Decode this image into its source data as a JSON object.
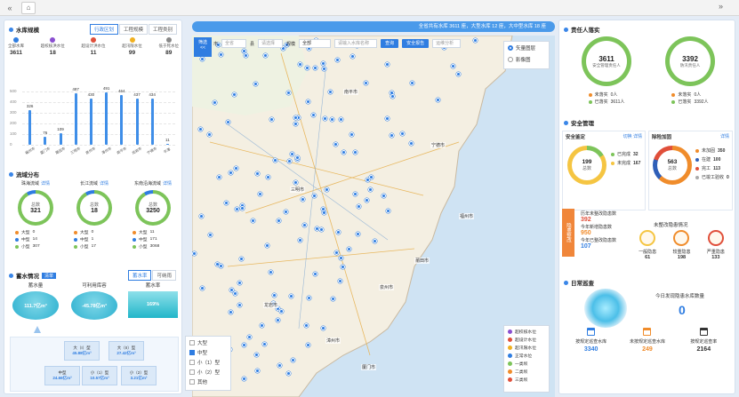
{
  "topbar": {
    "back": "«",
    "home": "⌂",
    "forward": "»"
  },
  "marquee": {
    "text": "全省共有水库 3611 座，大型水库 12 座，大中型水库 18 座"
  },
  "reservoir_scale": {
    "title": "水库规模",
    "tabs": [
      "行政区划",
      "工程规模",
      "工程类别"
    ],
    "stats": [
      {
        "label": "全部水库",
        "value": "3611",
        "color": "#2f7de1"
      },
      {
        "label": "超校核洪水位",
        "value": "18",
        "color": "#8a4fd0"
      },
      {
        "label": "超设计洪水位",
        "value": "11",
        "color": "#e04f3a"
      },
      {
        "label": "超汛限水位",
        "value": "99",
        "color": "#f0b020"
      },
      {
        "label": "低于死水位",
        "value": "89",
        "color": "#888888"
      }
    ]
  },
  "chart_data": {
    "type": "bar",
    "categories": [
      "福州市",
      "厦门市",
      "莆田市",
      "三明市",
      "泉州市",
      "漳州市",
      "南平市",
      "龙岩市",
      "宁德市",
      "平潭"
    ],
    "values": [
      326,
      76,
      109,
      487,
      430,
      491,
      464,
      437,
      434,
      11
    ],
    "yticks": [
      "500",
      "400",
      "300",
      "200",
      "100",
      "0"
    ],
    "ylim": [
      0,
      500
    ]
  },
  "basin": {
    "title": "流域分布",
    "items": [
      {
        "name": "珠海流域",
        "link": "详情",
        "total_label": "总数",
        "total": "321",
        "rows": [
          {
            "k": "大型",
            "v": "0"
          },
          {
            "k": "中型",
            "v": "14"
          },
          {
            "k": "小型",
            "v": "307"
          }
        ]
      },
      {
        "name": "长江流域",
        "link": "详情",
        "total_label": "总数",
        "total": "18",
        "rows": [
          {
            "k": "大型",
            "v": "0"
          },
          {
            "k": "中型",
            "v": "1"
          },
          {
            "k": "小型",
            "v": "17"
          }
        ]
      },
      {
        "name": "东南沿海流域",
        "link": "详情",
        "total_label": "总数",
        "total": "3250",
        "rows": [
          {
            "k": "大型",
            "v": "11"
          },
          {
            "k": "中型",
            "v": "171"
          },
          {
            "k": "小型",
            "v": "3068"
          }
        ]
      }
    ]
  },
  "storage": {
    "title": "蓄水情况",
    "tag": "清单",
    "tabs": [
      "蓄水率",
      "可纳雨"
    ],
    "cols": [
      {
        "label": "蓄水量",
        "value": "111.7亿m³"
      },
      {
        "label": "可利用库容",
        "value": "-45.78亿m³"
      },
      {
        "label": "蓄水率",
        "value": "169%"
      }
    ],
    "chips": [
      {
        "label": "大（I）型",
        "value": "45.88亿m³"
      },
      {
        "label": "大（II）型",
        "value": "27.42亿m³"
      },
      {
        "label": "中型",
        "value": "24.66亿m³"
      },
      {
        "label": "小（1）型",
        "value": "10.57亿m³"
      },
      {
        "label": "小（2）型",
        "value": "3.21亿m³"
      }
    ]
  },
  "map": {
    "filter_btn": "筛选",
    "city_label": "市",
    "city_ph": "全省",
    "county_label": "县",
    "county_ph": "请选择",
    "scale_label": "规模",
    "scale_value": "全部",
    "name_ph": "请输入水库名称",
    "query": "查询",
    "safety_report": "安全报告",
    "maintenance": "运维分析",
    "layer_options": [
      "矢量图层",
      "影像图"
    ],
    "type_filters": [
      {
        "label": "大型",
        "checked": false
      },
      {
        "label": "中型",
        "checked": true
      },
      {
        "label": "小（1）型",
        "checked": false
      },
      {
        "label": "小（2）型",
        "checked": false
      },
      {
        "label": "其他",
        "checked": false
      }
    ],
    "legend": [
      "超校核水位",
      "超设计水位",
      "超汛限水位",
      "正常水位",
      "一类坝",
      "二类坝",
      "三类坝"
    ],
    "cities": [
      "南平市",
      "宁德市",
      "福州市",
      "三明市",
      "莆田市",
      "泉州市",
      "龙岩市",
      "漳州市",
      "厦门市"
    ]
  },
  "responsible": {
    "title": "责任人落实",
    "items": [
      {
        "value": "3611",
        "label": "安全管理责任人",
        "rows": [
          {
            "k": "未落实",
            "v": "0人"
          },
          {
            "k": "已落实",
            "v": "3611人"
          }
        ]
      },
      {
        "value": "3392",
        "label": "防汛责任人",
        "rows": [
          {
            "k": "未落实",
            "v": "0人"
          },
          {
            "k": "已落实",
            "v": "3392人"
          }
        ]
      }
    ]
  },
  "safety": {
    "title": "安全管理",
    "left": {
      "title": "安全鉴定",
      "links": [
        "切换",
        "详情"
      ],
      "total": "199",
      "total_label": "总数",
      "rows": [
        {
          "k": "已完成",
          "v": "32"
        },
        {
          "k": "未完成",
          "v": "167"
        }
      ]
    },
    "right": {
      "title": "除险加固",
      "link": "详情",
      "total": "563",
      "total_label": "总数",
      "rows": [
        {
          "k": "未加固",
          "v": "350"
        },
        {
          "k": "在建",
          "v": "100"
        },
        {
          "k": "完工",
          "v": "113"
        },
        {
          "k": "已竣工验收",
          "v": "0"
        }
      ]
    }
  },
  "hazard": {
    "tag": "隐患整改",
    "rows": [
      {
        "k": "历年未整改隐患数",
        "v": "392"
      },
      {
        "k": "今年新增隐患数",
        "v": "950"
      },
      {
        "k": "今年已整改隐患数",
        "v": "107"
      }
    ],
    "unfixed_title": "未整改隐患情况",
    "levels": [
      {
        "k": "一般隐患",
        "v": "61"
      },
      {
        "k": "较重隐患",
        "v": "198"
      },
      {
        "k": "严重隐患",
        "v": "133"
      }
    ]
  },
  "patrol": {
    "title": "日常巡查",
    "today_label": "今日发现隐患水库数量",
    "today_value": "0",
    "items": [
      {
        "k": "按规定巡查水库",
        "v": "3340",
        "color": "#2f7de1"
      },
      {
        "k": "未按规定巡查水库",
        "v": "249",
        "color": "#f08c2b"
      },
      {
        "k": "按规定巡查率",
        "v": "2164",
        "color": "#333333"
      }
    ]
  }
}
